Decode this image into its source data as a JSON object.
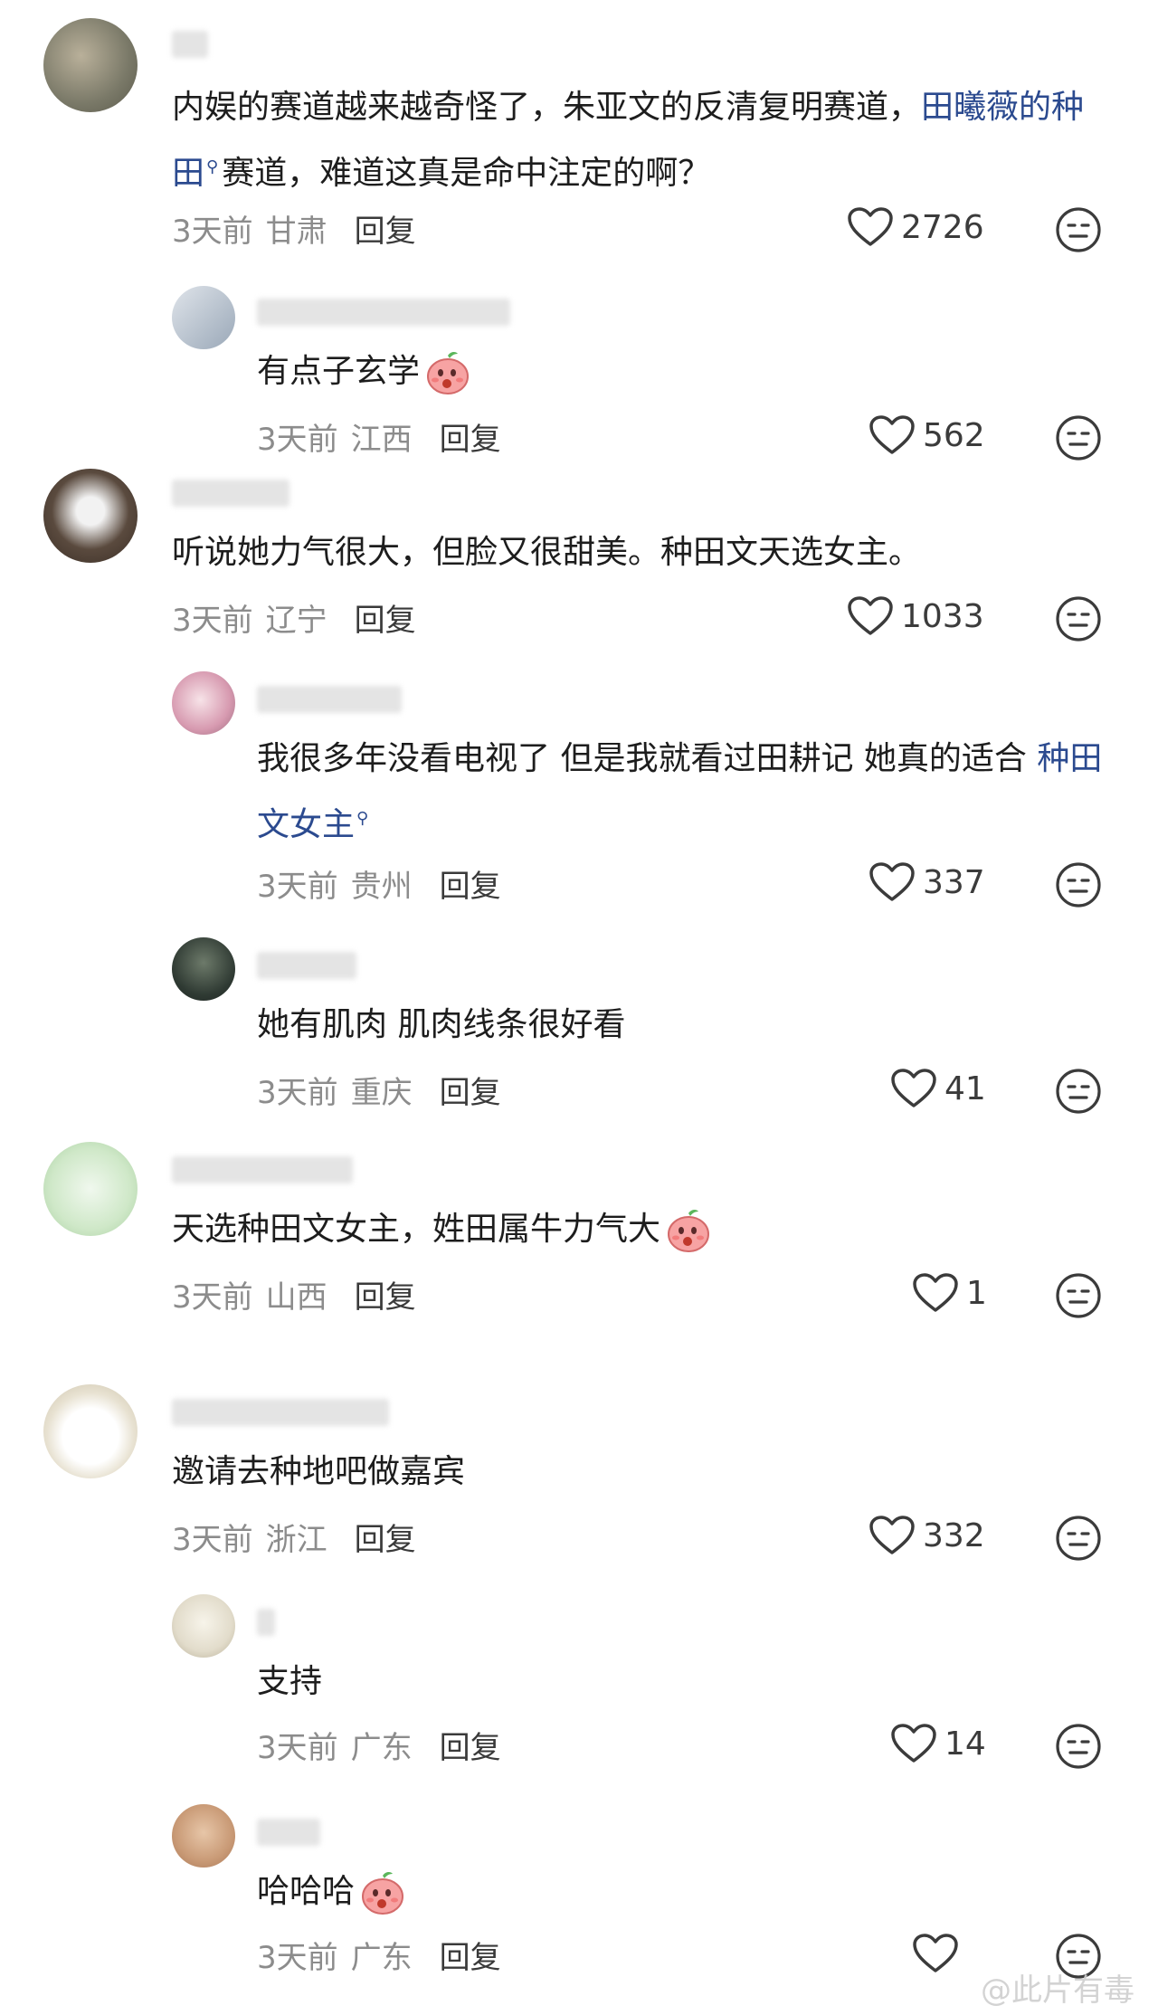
{
  "comments": [
    {
      "name": "",
      "text_parts": [
        "内娱的赛道越来越奇怪了，朱亚文的反清复明赛道，"
      ],
      "link": "田曦薇的种田",
      "text_after": "赛道，难道这真是命中注定的啊？",
      "time": "3天前",
      "region": "甘肃",
      "reply": "回复",
      "likes": "2726"
    },
    {
      "name": "",
      "text": "有点子玄学",
      "time": "3天前",
      "region": "江西",
      "reply": "回复",
      "likes": "562"
    },
    {
      "name": "",
      "text": "听说她力气很大，但脸又很甜美。种田文天选女主。",
      "time": "3天前",
      "region": "辽宁",
      "reply": "回复",
      "likes": "1033"
    },
    {
      "name": "",
      "text_before": "我很多年没看电视了 但是我就看过田耕记 她真的适合 ",
      "link": "种田文女主",
      "time": "3天前",
      "region": "贵州",
      "reply": "回复",
      "likes": "337"
    },
    {
      "name": "",
      "text": "她有肌肉 肌肉线条很好看",
      "time": "3天前",
      "region": "重庆",
      "reply": "回复",
      "likes": "41"
    },
    {
      "name": "",
      "text": "天选种田文女主，姓田属牛力气大",
      "time": "3天前",
      "region": "山西",
      "reply": "回复",
      "likes": "1"
    },
    {
      "name": "",
      "text": "邀请去种地吧做嘉宾",
      "time": "3天前",
      "region": "浙江",
      "reply": "回复",
      "likes": "332"
    },
    {
      "name": "",
      "text": "支持",
      "time": "3天前",
      "region": "广东",
      "reply": "回复",
      "likes": "14"
    },
    {
      "name": "",
      "text": "哈哈哈",
      "time": "3天前",
      "region": "广东",
      "reply": "回复",
      "likes": ""
    }
  ],
  "watermark": "@此片有毒",
  "icons": {
    "like": "heart-outline-icon",
    "face": "neutral-face-icon",
    "search": "search-icon",
    "emoji": "peach-emoji-icon"
  },
  "colors": {
    "link": "#2b4a8f",
    "meta": "#8c8c8c",
    "text": "#1d1d1d"
  }
}
